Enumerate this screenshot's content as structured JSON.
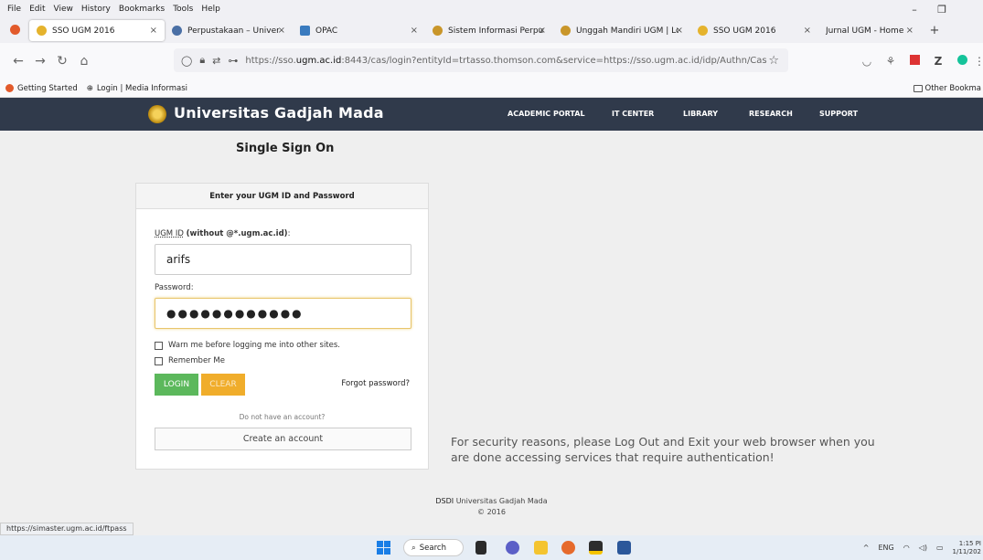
{
  "browser": {
    "menu": [
      "File",
      "Edit",
      "View",
      "History",
      "Bookmarks",
      "Tools",
      "Help"
    ],
    "tabs": [
      {
        "label": "SSO UGM 2016",
        "active": true
      },
      {
        "label": "Perpustakaan – Universitas",
        "active": false
      },
      {
        "label": "OPAC",
        "active": false
      },
      {
        "label": "Sistem Informasi Perpustak",
        "active": false
      },
      {
        "label": "Unggah Mandiri UGM | Log",
        "active": false
      },
      {
        "label": "SSO UGM 2016",
        "active": false
      },
      {
        "label": "Jurnal UGM - Home",
        "active": false
      }
    ],
    "url_prefix": "https://sso.",
    "url_domain": "ugm.ac.id",
    "url_rest": ":8443/cas/login?entityId=trtasso.thomson.com&service=https://sso.ugm.ac.id/idp/Authn/Cas",
    "bookmarks": [
      "Getting Started",
      "Login | Media Informasi"
    ],
    "other_bookmarks": "Other Bookma",
    "status_url": "https://simaster.ugm.ac.id/ftpass"
  },
  "site": {
    "name": "Universitas Gadjah Mada",
    "nav": [
      "ACADEMIC PORTAL",
      "IT CENTER",
      "LIBRARY",
      "RESEARCH",
      "SUPPORT"
    ]
  },
  "sso": {
    "title": "Single Sign On",
    "panel_heading": "Enter your UGM ID and Password",
    "id_label": "UGM ID",
    "id_hint": "(without @*.ugm.ac.id)",
    "id_label_colon": ":",
    "id_value": "arifs",
    "pw_label": "Password:",
    "pw_value": "●●●●●●●●●●●●",
    "warn_label": "Warn me before logging me into other sites.",
    "remember_label": "Remember Me",
    "login_label": "LOGIN",
    "clear_label": "CLEAR",
    "forgot_label": "Forgot password?",
    "no_account": "Do not have an account?",
    "create_label": "Create an account",
    "notice": "For security reasons, please Log Out and Exit your web browser when you are done accessing services that require authentication!"
  },
  "footer": {
    "org_bold": "DSDI",
    "org": "Universitas Gadjah Mada",
    "copyright": "© 2016"
  },
  "taskbar": {
    "search_label": "Search",
    "lang": "ENG",
    "time": "1:15 PI",
    "date": "1/11/202"
  },
  "colors": {
    "header_bg": "#303a4b",
    "login_green": "#5cb85c",
    "clear_orange": "#f0ad2b"
  }
}
